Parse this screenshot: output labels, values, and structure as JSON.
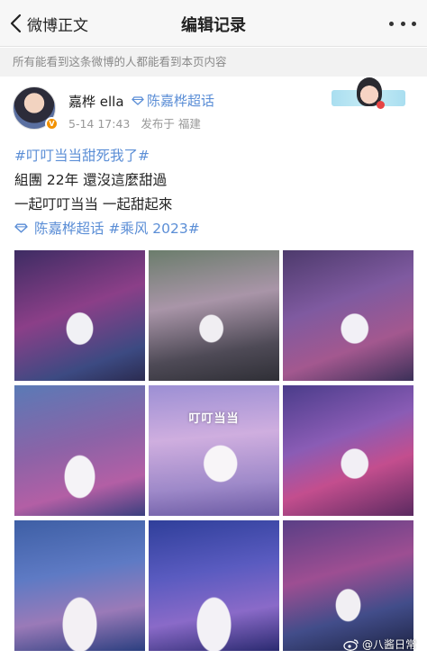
{
  "nav": {
    "back_label": "微博正文",
    "title": "编辑记录"
  },
  "visibility_notice": "所有能看到这条微博的人都能看到本页内容",
  "author": {
    "name": "嘉桦 ella",
    "super_topic": "陈嘉桦超话",
    "date_time": "5-14 17:43",
    "location_label": "发布于 福建"
  },
  "post": {
    "lines": [
      "#叮叮当当甜死我了#",
      "組團 22年 還沒這麼甜過",
      "一起叮叮当当 一起甜起來"
    ],
    "tag_line": {
      "super_topic": "陈嘉桦超话",
      "hashtag": "#乘风 2023#"
    }
  },
  "photos": [
    {
      "caption": ""
    },
    {
      "caption": ""
    },
    {
      "caption": ""
    },
    {
      "caption": ""
    },
    {
      "caption": "叮叮当当"
    },
    {
      "caption": ""
    },
    {
      "caption": ""
    },
    {
      "caption": ""
    },
    {
      "caption": ""
    }
  ],
  "watermark": "@八酱日常",
  "colors": {
    "link_blue": "#5b8ed6",
    "badge_orange": "#f29100",
    "notice_gray": "#8a8a8a"
  }
}
